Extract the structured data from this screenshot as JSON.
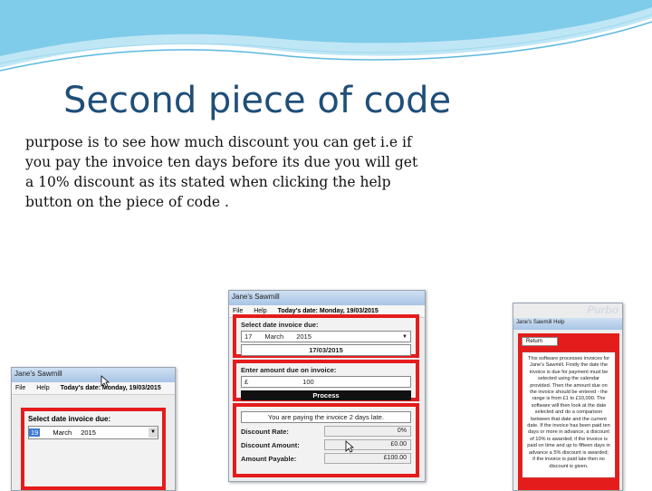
{
  "slide": {
    "title": "Second piece of code",
    "body": "purpose is to see how much discount you can get i.e if you pay the invoice ten days before its due you will get a 10% discount as its stated when clicking the help button on the piece of code ."
  },
  "colors": {
    "accent_red": "#e51c1c",
    "title_blue": "#1f4e79",
    "wave_blue": "#5bb8e0"
  },
  "window_small": {
    "title": "Jane's Sawmill",
    "menu": [
      "File",
      "Help"
    ],
    "date_today": "Today's date: Monday, 19/03/2015",
    "label": "Select date invoice due:",
    "day": "19",
    "month": "March",
    "year": "2015",
    "icons": [
      "cursor-arrow-icon",
      "dropdown-arrow-icon"
    ]
  },
  "window_main": {
    "title": "Jane's Sawmill",
    "menu": [
      "File",
      "Help"
    ],
    "date_today": "Today's date: Monday, 19/03/2015",
    "select_label": "Select date invoice due:",
    "day": "17",
    "month": "March",
    "year": "2015",
    "selected_date": "17/03/2015",
    "amount_label": "Enter amount due on invoice:",
    "currency": "£",
    "amount": "100",
    "process_label": "Process",
    "status_msg": "You are paying the invoice 2 days late.",
    "rows": [
      {
        "label": "Discount Rate:",
        "value": "0%"
      },
      {
        "label": "Discount Amount:",
        "value": "£0.00"
      },
      {
        "label": "Amount Payable:",
        "value": "£100.00"
      }
    ]
  },
  "window_help": {
    "logo": "Purbo",
    "title": "Jane's Sawmill Help",
    "return_label": "Return",
    "text": "This software processes invoices for Jane's Sawmill. Firstly the date the invoice is due for payment must be selected using the calendar provided. Then the amount due on the invoice should be entered - the range is from £1 to £10,000. The software will then look at the date selected and do a comparison between that date and the current date. If the invoice has been paid ten days or more in advance, a discount of 10% is awarded; if the invoice is paid on time and up to fifteen days in advance a 5% discount is awarded; if the invoice is paid late then no discount is given."
  }
}
